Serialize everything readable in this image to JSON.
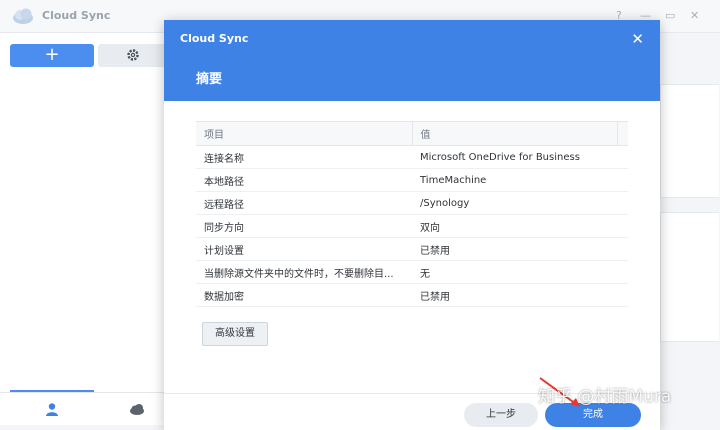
{
  "app": {
    "title": "Cloud Sync",
    "window_controls": [
      "?",
      "—",
      "▭",
      "✕"
    ]
  },
  "sidebar": {
    "add_label": "+",
    "bottom_tabs": [
      "user-icon",
      "cloud-icon"
    ]
  },
  "dialog": {
    "app_title": "Cloud Sync",
    "close_label": "✕",
    "heading": "摘要",
    "table": {
      "headers": [
        "项目",
        "值"
      ],
      "rows": [
        {
          "key": "连接名称",
          "value": "Microsoft OneDrive for Business"
        },
        {
          "key": "本地路径",
          "value": "TimeMachine"
        },
        {
          "key": "远程路径",
          "value": "/Synology"
        },
        {
          "key": "同步方向",
          "value": "双向"
        },
        {
          "key": "计划设置",
          "value": "已禁用"
        },
        {
          "key": "当删除源文件夹中的文件时，不要删除目...",
          "value": "无"
        },
        {
          "key": "数据加密",
          "value": "已禁用"
        }
      ]
    },
    "advanced_label": "高级设置",
    "prev_label": "上一步",
    "done_label": "完成"
  },
  "watermark": "知乎 @村雨Mura",
  "colors": {
    "accent": "#3f82e6",
    "add_button": "#4b8ef0"
  }
}
